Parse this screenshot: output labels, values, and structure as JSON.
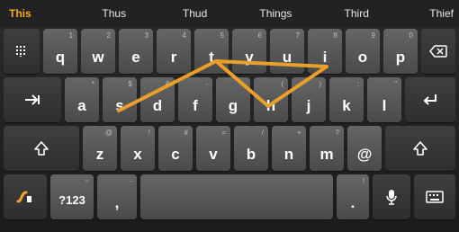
{
  "suggestions": [
    "This",
    "Thus",
    "Thud",
    "Things",
    "Third",
    "Thief"
  ],
  "rows": [
    [
      {
        "name": "symbols-grid-key",
        "label": "",
        "sub": "",
        "func": true,
        "icon": "grid-dots-icon"
      },
      {
        "name": "key-q",
        "label": "q",
        "sub": "1"
      },
      {
        "name": "key-w",
        "label": "w",
        "sub": "2"
      },
      {
        "name": "key-e",
        "label": "e",
        "sub": "3"
      },
      {
        "name": "key-r",
        "label": "r",
        "sub": "4"
      },
      {
        "name": "key-t",
        "label": "t",
        "sub": "5"
      },
      {
        "name": "key-y",
        "label": "y",
        "sub": "6"
      },
      {
        "name": "key-u",
        "label": "u",
        "sub": "7"
      },
      {
        "name": "key-i",
        "label": "i",
        "sub": "8"
      },
      {
        "name": "key-o",
        "label": "o",
        "sub": "9"
      },
      {
        "name": "key-p",
        "label": "p",
        "sub": "0"
      },
      {
        "name": "backspace-key",
        "label": "",
        "sub": "",
        "func": true,
        "icon": "backspace-icon"
      }
    ],
    [
      {
        "name": "tab-key",
        "label": "",
        "sub": "",
        "func": true,
        "icon": "tab-arrow-icon"
      },
      {
        "name": "key-a",
        "label": "a",
        "sub": "*"
      },
      {
        "name": "key-s",
        "label": "s",
        "sub": "$"
      },
      {
        "name": "key-d",
        "label": "d",
        "sub": "&"
      },
      {
        "name": "key-f",
        "label": "f",
        "sub": "-"
      },
      {
        "name": "key-g",
        "label": "g",
        "sub": "+"
      },
      {
        "name": "key-h",
        "label": "h",
        "sub": "("
      },
      {
        "name": "key-j",
        "label": "j",
        "sub": ")"
      },
      {
        "name": "key-k",
        "label": "k",
        "sub": ";"
      },
      {
        "name": "key-l",
        "label": "l",
        "sub": "\""
      },
      {
        "name": "enter-key",
        "label": "",
        "sub": "",
        "func": true,
        "icon": "enter-icon"
      }
    ],
    [
      {
        "name": "shift-left-key",
        "label": "",
        "sub": "",
        "func": true,
        "icon": "shift-icon"
      },
      {
        "name": "key-z",
        "label": "z",
        "sub": "@"
      },
      {
        "name": "key-x",
        "label": "x",
        "sub": "!"
      },
      {
        "name": "key-c",
        "label": "c",
        "sub": "#"
      },
      {
        "name": "key-v",
        "label": "v",
        "sub": "="
      },
      {
        "name": "key-b",
        "label": "b",
        "sub": "/"
      },
      {
        "name": "key-n",
        "label": "n",
        "sub": "+"
      },
      {
        "name": "key-m",
        "label": "m",
        "sub": "?"
      },
      {
        "name": "key-at",
        "label": "@",
        "sub": ""
      },
      {
        "name": "shift-right-key",
        "label": "",
        "sub": "",
        "func": true,
        "icon": "shift-icon"
      }
    ],
    [
      {
        "name": "swype-key",
        "label": "",
        "sub": "",
        "func": true,
        "icon": "swype-logo-icon"
      },
      {
        "name": "numbers-key",
        "label": "?123",
        "sub": "~"
      },
      {
        "name": "key-comma",
        "label": ",",
        "sub": "-"
      },
      {
        "name": "space-key",
        "label": "",
        "sub": ""
      },
      {
        "name": "key-period",
        "label": ".",
        "sub": "!"
      },
      {
        "name": "mic-key",
        "label": "",
        "sub": "",
        "func": true,
        "icon": "microphone-icon"
      },
      {
        "name": "keyboard-key",
        "label": "",
        "sub": "",
        "func": true,
        "icon": "keyboard-icon"
      }
    ]
  ],
  "colors": {
    "accent": "#f5a623",
    "trail": "#e8a02a"
  }
}
